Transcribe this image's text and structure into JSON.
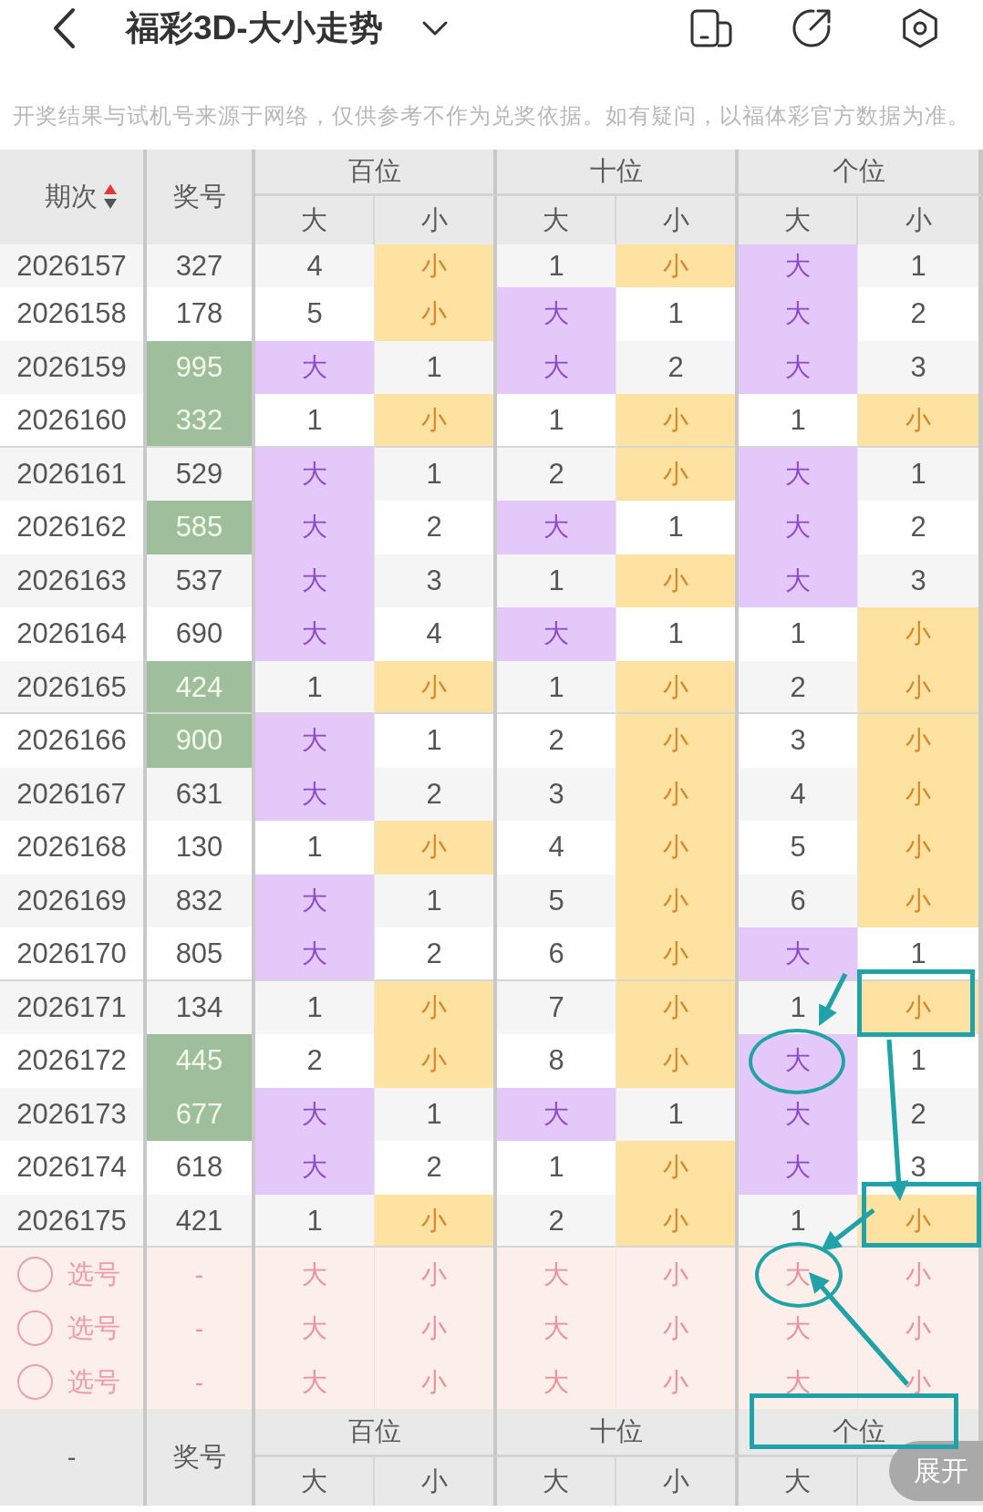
{
  "header": {
    "title": "福彩3D-大小走势",
    "notice": "开奖结果与试机号来源于网络，仅供参考不作为兑奖依据。如有疑问，以福体彩官方数据为准。"
  },
  "table": {
    "columns": [
      {
        "label": "期次",
        "sorted": true,
        "ascending": true
      },
      {
        "label": "奖号",
        "sorted": false
      }
    ],
    "groups": [
      {
        "label": "百位",
        "columns": [
          {
            "label": "大",
            "kind": "big"
          },
          {
            "label": "小",
            "kind": "small"
          }
        ]
      },
      {
        "label": "十位",
        "columns": [
          {
            "label": "大",
            "kind": "big"
          },
          {
            "label": "小",
            "kind": "small"
          }
        ]
      },
      {
        "label": "个位",
        "columns": [
          {
            "label": "大",
            "kind": "big"
          },
          {
            "label": "小",
            "kind": "small"
          }
        ]
      }
    ],
    "rows": [
      {
        "period": "2026157",
        "number": "327",
        "highlighted": false,
        "cells": [
          {
            "text": "4",
            "hit": false
          },
          {
            "text": "小",
            "hit": true
          },
          {
            "text": "1",
            "hit": false
          },
          {
            "text": "小",
            "hit": true
          },
          {
            "text": "大",
            "hit": true
          },
          {
            "text": "1",
            "hit": false
          }
        ]
      },
      {
        "period": "2026158",
        "number": "178",
        "highlighted": false,
        "cells": [
          {
            "text": "5",
            "hit": false
          },
          {
            "text": "小",
            "hit": true
          },
          {
            "text": "大",
            "hit": true
          },
          {
            "text": "1",
            "hit": false
          },
          {
            "text": "大",
            "hit": true
          },
          {
            "text": "2",
            "hit": false
          }
        ]
      },
      {
        "period": "2026159",
        "number": "995",
        "highlighted": true,
        "cells": [
          {
            "text": "大",
            "hit": true
          },
          {
            "text": "1",
            "hit": false
          },
          {
            "text": "大",
            "hit": true
          },
          {
            "text": "2",
            "hit": false
          },
          {
            "text": "大",
            "hit": true
          },
          {
            "text": "3",
            "hit": false
          }
        ]
      },
      {
        "period": "2026160",
        "number": "332",
        "highlighted": true,
        "cells": [
          {
            "text": "1",
            "hit": false
          },
          {
            "text": "小",
            "hit": true
          },
          {
            "text": "1",
            "hit": false
          },
          {
            "text": "小",
            "hit": true
          },
          {
            "text": "1",
            "hit": false
          },
          {
            "text": "小",
            "hit": true
          }
        ]
      },
      {
        "period": "2026161",
        "number": "529",
        "highlighted": false,
        "cells": [
          {
            "text": "大",
            "hit": true
          },
          {
            "text": "1",
            "hit": false
          },
          {
            "text": "2",
            "hit": false
          },
          {
            "text": "小",
            "hit": true
          },
          {
            "text": "大",
            "hit": true
          },
          {
            "text": "1",
            "hit": false
          }
        ]
      },
      {
        "period": "2026162",
        "number": "585",
        "highlighted": true,
        "cells": [
          {
            "text": "大",
            "hit": true
          },
          {
            "text": "2",
            "hit": false
          },
          {
            "text": "大",
            "hit": true
          },
          {
            "text": "1",
            "hit": false
          },
          {
            "text": "大",
            "hit": true
          },
          {
            "text": "2",
            "hit": false
          }
        ]
      },
      {
        "period": "2026163",
        "number": "537",
        "highlighted": false,
        "cells": [
          {
            "text": "大",
            "hit": true
          },
          {
            "text": "3",
            "hit": false
          },
          {
            "text": "1",
            "hit": false
          },
          {
            "text": "小",
            "hit": true
          },
          {
            "text": "大",
            "hit": true
          },
          {
            "text": "3",
            "hit": false
          }
        ]
      },
      {
        "period": "2026164",
        "number": "690",
        "highlighted": false,
        "cells": [
          {
            "text": "大",
            "hit": true
          },
          {
            "text": "4",
            "hit": false
          },
          {
            "text": "大",
            "hit": true
          },
          {
            "text": "1",
            "hit": false
          },
          {
            "text": "1",
            "hit": false
          },
          {
            "text": "小",
            "hit": true
          }
        ]
      },
      {
        "period": "2026165",
        "number": "424",
        "highlighted": true,
        "cells": [
          {
            "text": "1",
            "hit": false
          },
          {
            "text": "小",
            "hit": true
          },
          {
            "text": "1",
            "hit": false
          },
          {
            "text": "小",
            "hit": true
          },
          {
            "text": "2",
            "hit": false
          },
          {
            "text": "小",
            "hit": true
          }
        ]
      },
      {
        "period": "2026166",
        "number": "900",
        "highlighted": true,
        "cells": [
          {
            "text": "大",
            "hit": true
          },
          {
            "text": "1",
            "hit": false
          },
          {
            "text": "2",
            "hit": false
          },
          {
            "text": "小",
            "hit": true
          },
          {
            "text": "3",
            "hit": false
          },
          {
            "text": "小",
            "hit": true
          }
        ]
      },
      {
        "period": "2026167",
        "number": "631",
        "highlighted": false,
        "cells": [
          {
            "text": "大",
            "hit": true
          },
          {
            "text": "2",
            "hit": false
          },
          {
            "text": "3",
            "hit": false
          },
          {
            "text": "小",
            "hit": true
          },
          {
            "text": "4",
            "hit": false
          },
          {
            "text": "小",
            "hit": true
          }
        ]
      },
      {
        "period": "2026168",
        "number": "130",
        "highlighted": false,
        "cells": [
          {
            "text": "1",
            "hit": false
          },
          {
            "text": "小",
            "hit": true
          },
          {
            "text": "4",
            "hit": false
          },
          {
            "text": "小",
            "hit": true
          },
          {
            "text": "5",
            "hit": false
          },
          {
            "text": "小",
            "hit": true
          }
        ]
      },
      {
        "period": "2026169",
        "number": "832",
        "highlighted": false,
        "cells": [
          {
            "text": "大",
            "hit": true
          },
          {
            "text": "1",
            "hit": false
          },
          {
            "text": "5",
            "hit": false
          },
          {
            "text": "小",
            "hit": true
          },
          {
            "text": "6",
            "hit": false
          },
          {
            "text": "小",
            "hit": true
          }
        ]
      },
      {
        "period": "2026170",
        "number": "805",
        "highlighted": false,
        "cells": [
          {
            "text": "大",
            "hit": true
          },
          {
            "text": "2",
            "hit": false
          },
          {
            "text": "6",
            "hit": false
          },
          {
            "text": "小",
            "hit": true
          },
          {
            "text": "大",
            "hit": true
          },
          {
            "text": "1",
            "hit": false
          }
        ]
      },
      {
        "period": "2026171",
        "number": "134",
        "highlighted": false,
        "cells": [
          {
            "text": "1",
            "hit": false
          },
          {
            "text": "小",
            "hit": true
          },
          {
            "text": "7",
            "hit": false
          },
          {
            "text": "小",
            "hit": true
          },
          {
            "text": "1",
            "hit": false
          },
          {
            "text": "小",
            "hit": true
          }
        ]
      },
      {
        "period": "2026172",
        "number": "445",
        "highlighted": true,
        "cells": [
          {
            "text": "2",
            "hit": false
          },
          {
            "text": "小",
            "hit": true
          },
          {
            "text": "8",
            "hit": false
          },
          {
            "text": "小",
            "hit": true
          },
          {
            "text": "大",
            "hit": true
          },
          {
            "text": "1",
            "hit": false
          }
        ]
      },
      {
        "period": "2026173",
        "number": "677",
        "highlighted": true,
        "cells": [
          {
            "text": "大",
            "hit": true
          },
          {
            "text": "1",
            "hit": false
          },
          {
            "text": "大",
            "hit": true
          },
          {
            "text": "1",
            "hit": false
          },
          {
            "text": "大",
            "hit": true
          },
          {
            "text": "2",
            "hit": false
          }
        ]
      },
      {
        "period": "2026174",
        "number": "618",
        "highlighted": false,
        "cells": [
          {
            "text": "大",
            "hit": true
          },
          {
            "text": "2",
            "hit": false
          },
          {
            "text": "1",
            "hit": false
          },
          {
            "text": "小",
            "hit": true
          },
          {
            "text": "大",
            "hit": true
          },
          {
            "text": "3",
            "hit": false
          }
        ]
      },
      {
        "period": "2026175",
        "number": "421",
        "highlighted": false,
        "cells": [
          {
            "text": "1",
            "hit": false
          },
          {
            "text": "小",
            "hit": true
          },
          {
            "text": "2",
            "hit": false
          },
          {
            "text": "小",
            "hit": true
          },
          {
            "text": "1",
            "hit": false
          },
          {
            "text": "小",
            "hit": true
          }
        ]
      }
    ],
    "pick_rows": [
      {
        "label": "选号",
        "selected": false,
        "number": "-",
        "cells": [
          {
            "text": "大",
            "selected": false
          },
          {
            "text": "小",
            "selected": false
          },
          {
            "text": "大",
            "selected": false
          },
          {
            "text": "小",
            "selected": false
          },
          {
            "text": "大",
            "selected": false
          },
          {
            "text": "小",
            "selected": false
          }
        ]
      },
      {
        "label": "选号",
        "selected": false,
        "number": "-",
        "cells": [
          {
            "text": "大",
            "selected": false
          },
          {
            "text": "小",
            "selected": false
          },
          {
            "text": "大",
            "selected": false
          },
          {
            "text": "小",
            "selected": false
          },
          {
            "text": "大",
            "selected": false
          },
          {
            "text": "小",
            "selected": false
          }
        ]
      },
      {
        "label": "选号",
        "selected": false,
        "number": "-",
        "cells": [
          {
            "text": "大",
            "selected": false
          },
          {
            "text": "小",
            "selected": false
          },
          {
            "text": "大",
            "selected": false
          },
          {
            "text": "小",
            "selected": false
          },
          {
            "text": "大",
            "selected": false
          },
          {
            "text": "小",
            "selected": false
          }
        ]
      }
    ],
    "footer": {
      "period": "-",
      "number": "奖号",
      "groups": [
        {
          "label": "百位",
          "columns": [
            "大",
            "小"
          ]
        },
        {
          "label": "十位",
          "columns": [
            "大",
            "小"
          ]
        },
        {
          "label": "个位",
          "columns": [
            "大"
          ]
        }
      ]
    }
  },
  "expand_button": {
    "label": "展开"
  }
}
